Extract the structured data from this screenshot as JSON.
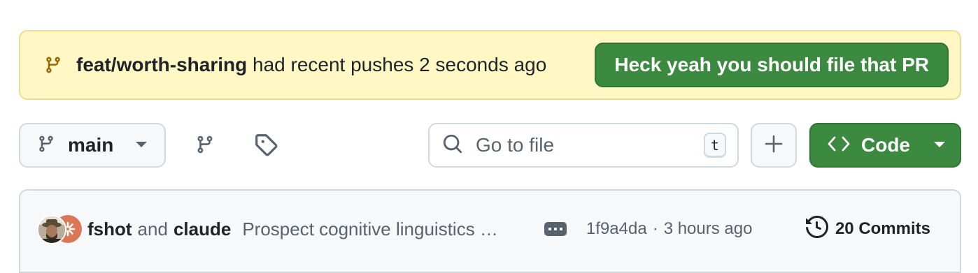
{
  "banner": {
    "branch_name": "feat/worth-sharing",
    "message": "had recent pushes 2 seconds ago",
    "button_label": "Heck yeah you should file that PR",
    "icon": "git-branch-icon",
    "background": "#fff8c5",
    "button_color": "#3c8a3f"
  },
  "toolbar": {
    "branch_label": "main",
    "branches_icon": "git-branch-icon",
    "tags_icon": "tag-icon",
    "search_placeholder": "Go to file",
    "search_shortcut": "t",
    "add_icon": "plus-icon",
    "code_label": "Code"
  },
  "commit": {
    "author1": "fshot",
    "and_text": "and",
    "author2": "claude",
    "message": "Prospect cognitive linguistics …",
    "sha": "1f9a4da",
    "separator": "·",
    "time": "3 hours ago",
    "commits_count": "20 Commits",
    "history_icon": "history-icon"
  }
}
